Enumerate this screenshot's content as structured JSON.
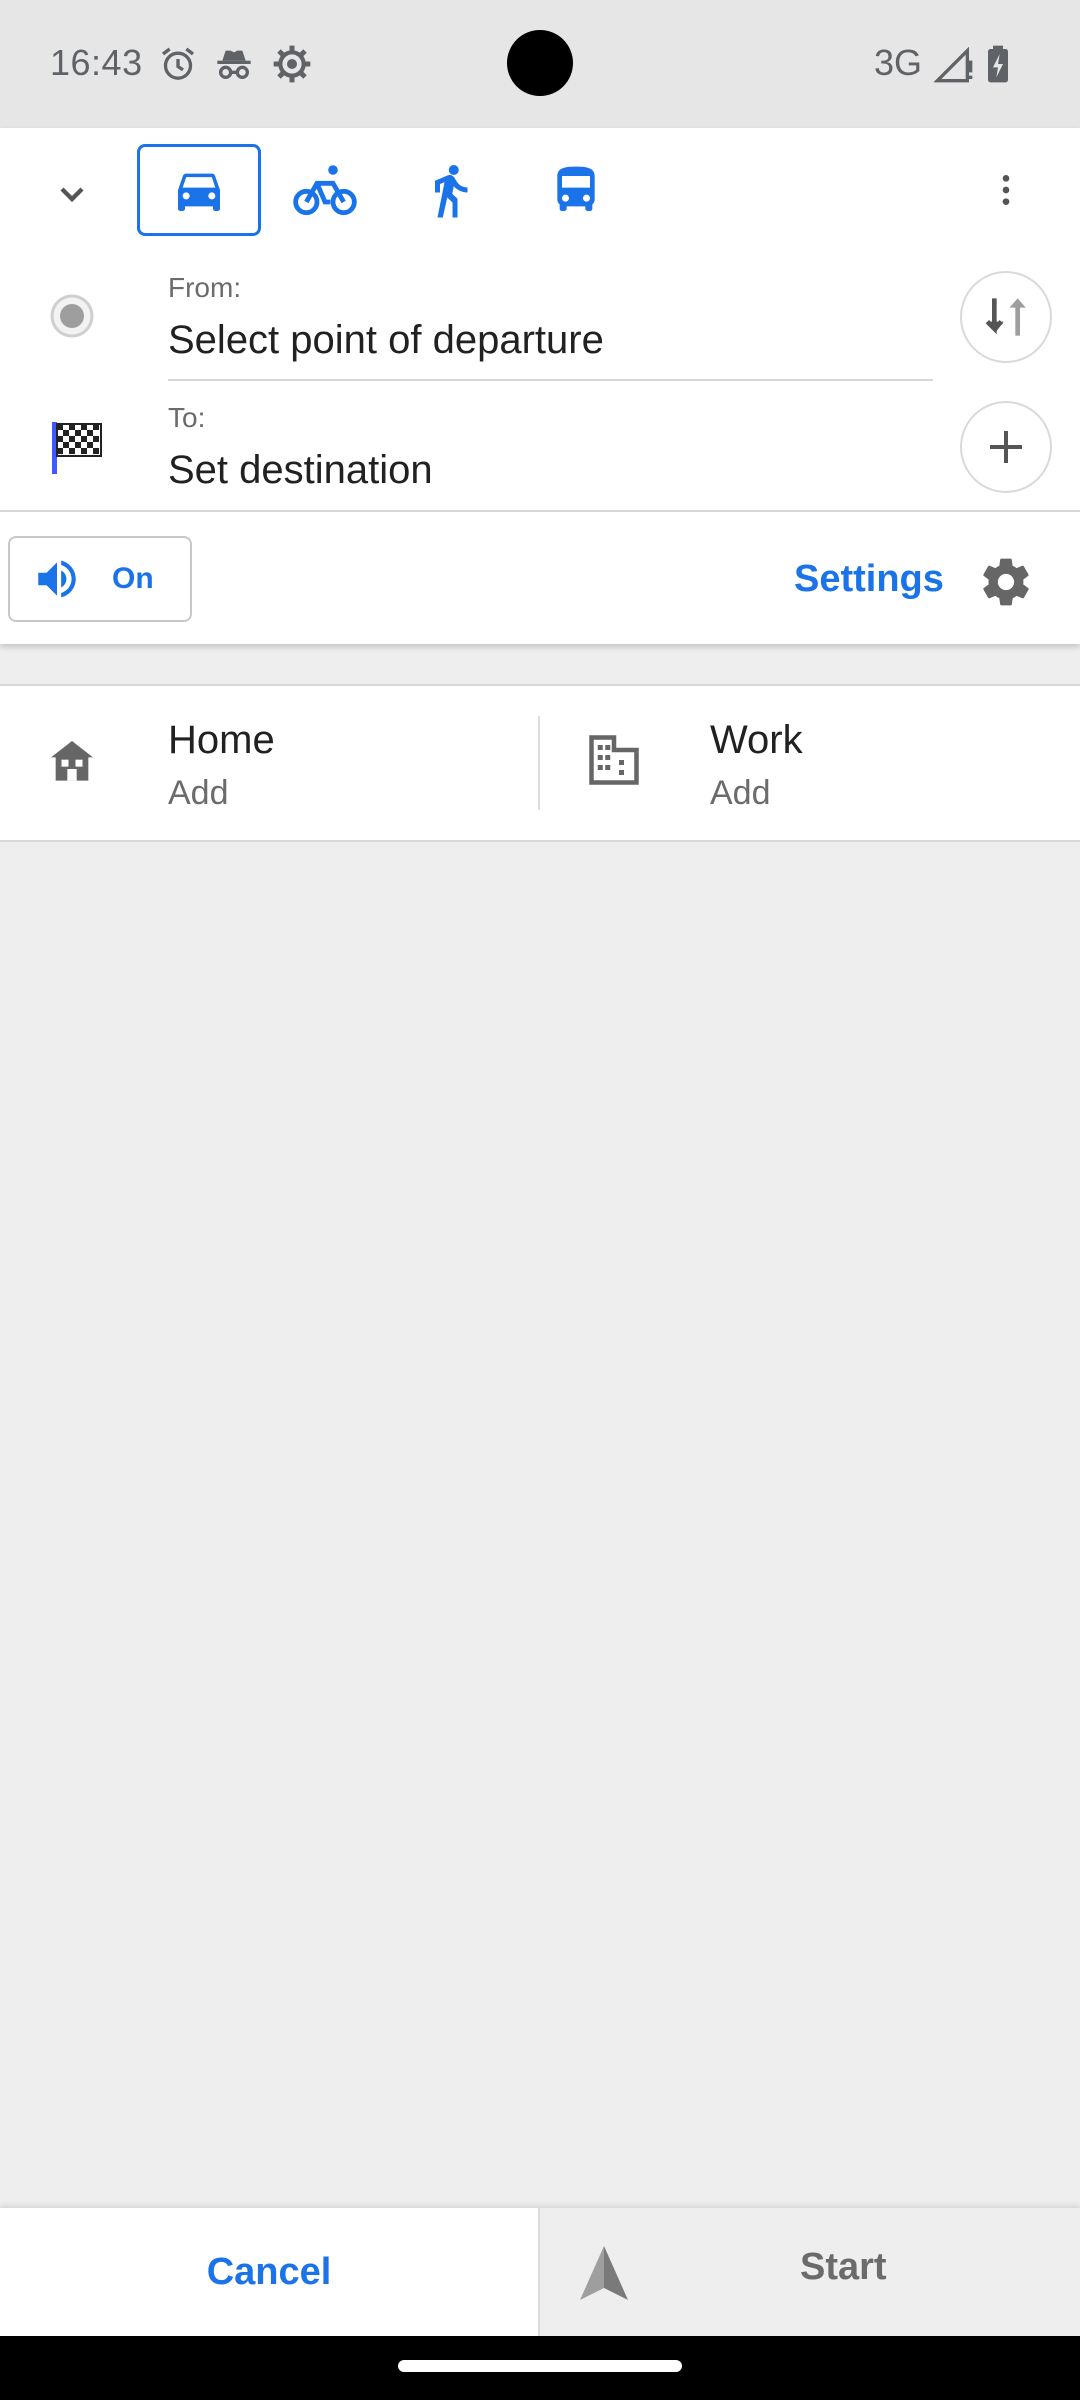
{
  "status_bar": {
    "time": "16:43",
    "network": "3G",
    "icons": [
      "alarm-icon",
      "incognito-icon",
      "settings-gear-icon",
      "signal-icon",
      "battery-charging-icon"
    ]
  },
  "route_panel": {
    "collapse_icon": "chevron-down-icon",
    "modes": [
      {
        "name": "car-icon",
        "active": true
      },
      {
        "name": "bicycle-icon",
        "active": false
      },
      {
        "name": "pedestrian-icon",
        "active": false
      },
      {
        "name": "bus-icon",
        "active": false
      }
    ],
    "more_icon": "more-vert-icon",
    "from": {
      "label": "From:",
      "value": "Select point of departure"
    },
    "to": {
      "label": "To:",
      "value": "Set destination"
    },
    "swap_icon": "swap-vert-icon",
    "add_icon": "plus-icon",
    "sound": {
      "label": "On",
      "icon": "volume-icon"
    },
    "settings": {
      "label": "Settings",
      "icon": "gear-icon"
    }
  },
  "places": {
    "home": {
      "title": "Home",
      "subtitle": "Add",
      "icon": "home-icon"
    },
    "work": {
      "title": "Work",
      "subtitle": "Add",
      "icon": "building-icon"
    }
  },
  "bottom_bar": {
    "cancel_label": "Cancel",
    "start_label": "Start",
    "start_icon": "navigation-arrow-icon"
  },
  "colors": {
    "accent": "#1a73e8",
    "panel_bg": "#ffffff",
    "screen_bg": "#eeeeee",
    "destination_flag": "#3d5afe"
  }
}
